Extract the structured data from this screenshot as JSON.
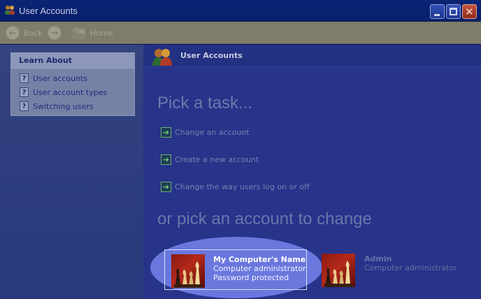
{
  "window": {
    "title": "User Accounts"
  },
  "toolbar": {
    "back_label": "Back",
    "home_label": "Home"
  },
  "learn_about": {
    "heading": "Learn About",
    "items": [
      {
        "label": "User accounts",
        "icon": "help-icon"
      },
      {
        "label": "User account types",
        "icon": "help-icon"
      },
      {
        "label": "Switching users",
        "icon": "help-icon"
      }
    ]
  },
  "main": {
    "header_title": "User Accounts",
    "pick_task_heading": "Pick a task...",
    "tasks": [
      {
        "label": "Change an account",
        "icon": "green-arrow-icon"
      },
      {
        "label": "Create a new account",
        "icon": "green-arrow-icon"
      },
      {
        "label": "Change the way users log on or off",
        "icon": "green-arrow-icon"
      }
    ],
    "pick_account_heading": "or pick an account to change",
    "accounts": [
      {
        "name": "My Computer's Name",
        "type": "Computer administrator",
        "status": "Password protected",
        "picture": "chess-picture"
      },
      {
        "name": "Admin",
        "type": "Computer administrator",
        "picture": "chess-picture"
      }
    ]
  },
  "colors": {
    "highlight": "#6a78de",
    "title_bar": "#0b2473",
    "toolbar": "#7f7c69"
  }
}
